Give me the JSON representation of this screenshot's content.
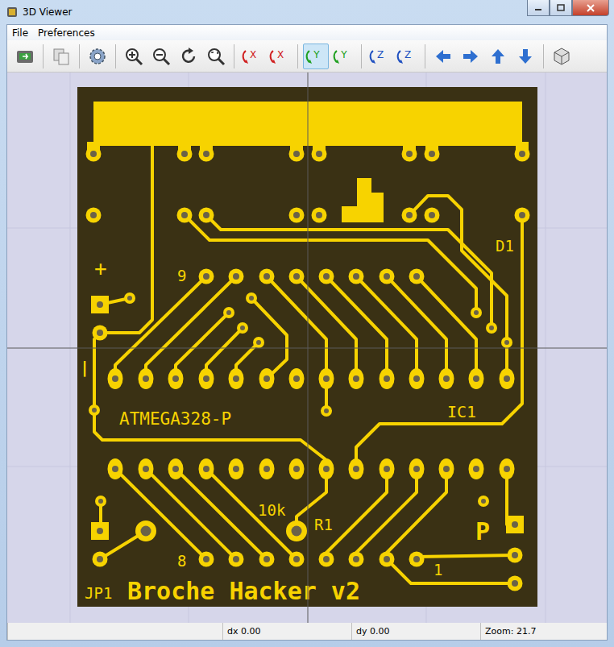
{
  "window": {
    "title": "3D Viewer"
  },
  "menu": [
    {
      "label": "File"
    },
    {
      "label": "Preferences"
    }
  ],
  "toolbar": [
    {
      "kind": "export",
      "label": "",
      "selected": false
    },
    {
      "kind": "copy",
      "label": "",
      "selected": false
    },
    {
      "kind": "settings",
      "label": "",
      "selected": false
    },
    {
      "kind": "zoom-in",
      "label": "",
      "selected": false
    },
    {
      "kind": "zoom-out",
      "label": "",
      "selected": false
    },
    {
      "kind": "redraw",
      "label": "",
      "selected": false
    },
    {
      "kind": "zoom-fit",
      "label": "",
      "selected": false
    },
    {
      "kind": "rot-x-neg",
      "label": "X",
      "selected": false
    },
    {
      "kind": "rot-x-pos",
      "label": "X",
      "selected": false
    },
    {
      "kind": "rot-y-neg",
      "label": "Y",
      "selected": true
    },
    {
      "kind": "rot-y-pos",
      "label": "Y",
      "selected": false
    },
    {
      "kind": "rot-z-neg",
      "label": "Z",
      "selected": false
    },
    {
      "kind": "rot-z-pos",
      "label": "Z",
      "selected": false
    },
    {
      "kind": "left",
      "label": "",
      "selected": false
    },
    {
      "kind": "right",
      "label": "",
      "selected": false
    },
    {
      "kind": "up",
      "label": "",
      "selected": false
    },
    {
      "kind": "down",
      "label": "",
      "selected": false
    },
    {
      "kind": "ortho",
      "label": "",
      "selected": false
    }
  ],
  "board": {
    "plus": "+",
    "minus": "|",
    "pin9": "9",
    "d1": "D1",
    "chip": "ATMEGA328-P",
    "ic1": "IC1",
    "resistor_value": "10k",
    "resistor_ref": "R1",
    "p": "P",
    "pin8": "8",
    "pin1": "1",
    "jp1": "JP1",
    "title": "Broche Hacker v2"
  },
  "status_bar": [
    "",
    "dx 0.00",
    "dy 0.00",
    "Zoom: 21.7"
  ]
}
